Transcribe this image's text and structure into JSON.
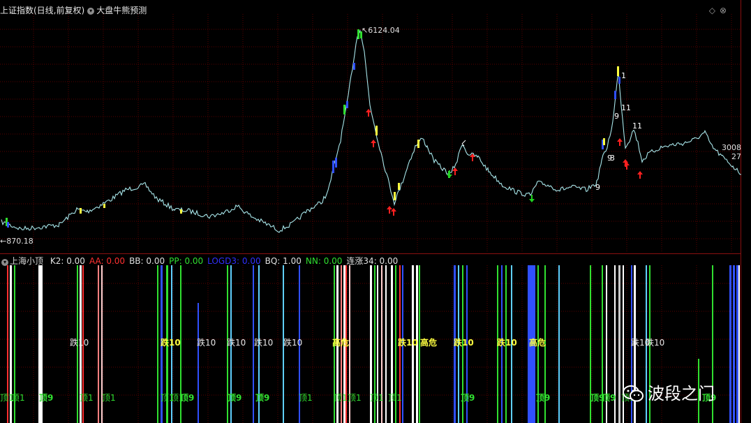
{
  "header": {
    "title": "上证指数(日线,前复权)",
    "indicator": "大盘牛熊预测",
    "corner_icons": [
      "diamond-icon",
      "close-icon"
    ]
  },
  "main_chart": {
    "high_label": "6124.04",
    "low_label": "870.18",
    "right_label_1": "3008",
    "right_label_2": "27",
    "markers": [
      "1",
      "9",
      "11",
      "9",
      "3",
      "11",
      "9"
    ]
  },
  "sub_header": {
    "name": "上海小顶",
    "items": [
      {
        "label": "K2: 0.00",
        "color": "#e0e0e0"
      },
      {
        "label": "AA: 0.00",
        "color": "#ff3030"
      },
      {
        "label": "BB: 0.00",
        "color": "#e0e0e0"
      },
      {
        "label": "PP: 0.00",
        "color": "#30e030"
      },
      {
        "label": "LOGD3: 0.00",
        "color": "#3030ff"
      },
      {
        "label": "BQ: 1.00",
        "color": "#e0e0e0"
      },
      {
        "label": "NN: 0.00",
        "color": "#30e030"
      },
      {
        "label": "连涨34: 0.00",
        "color": "#e0e0e0"
      }
    ]
  },
  "sub_labels": {
    "fall": "跌10",
    "top": "顶1",
    "top9": "顶9",
    "danger": "高危"
  },
  "watermark": "波段之门",
  "colors": {
    "background": "#000000",
    "grid": "#5a0000",
    "price_line": "#a8e6ea",
    "up_arrow": "#ff2020",
    "down_arrow": "#20d020"
  }
}
